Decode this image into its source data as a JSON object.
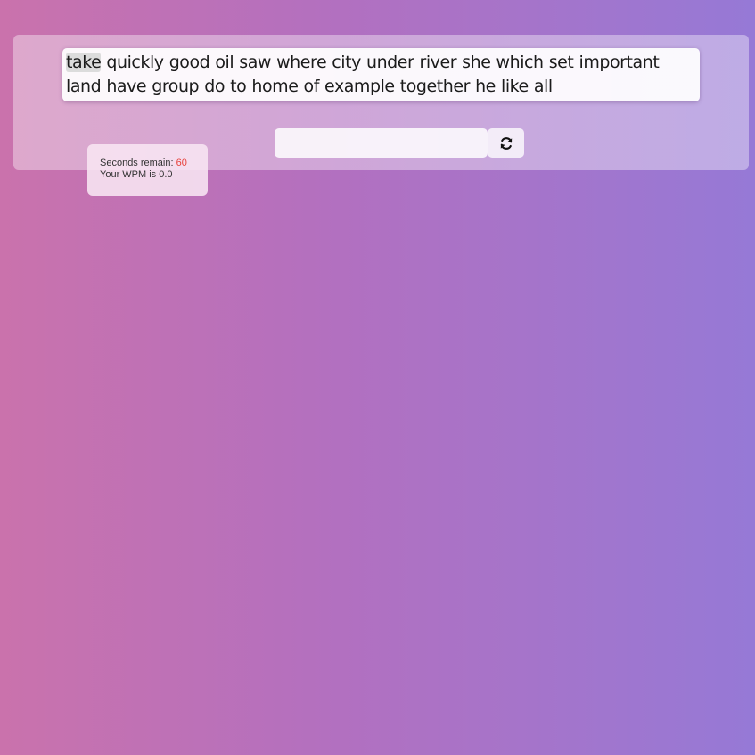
{
  "typing_test": {
    "current_word": "take",
    "remaining_text": " quickly good oil saw where city under river she which set important land have group do to home of example together he like all",
    "input": {
      "value": "",
      "placeholder": ""
    },
    "reset_icon": "refresh-icon"
  },
  "stats": {
    "seconds_label": "Seconds remain:",
    "seconds_value": "60",
    "wpm_text": "Your WPM is 0.0"
  },
  "colors": {
    "background_left": "#ca72ac",
    "background_right": "#9679d6",
    "seconds_value": "#e8413a",
    "current_word_highlight": "#dcdcdc"
  }
}
